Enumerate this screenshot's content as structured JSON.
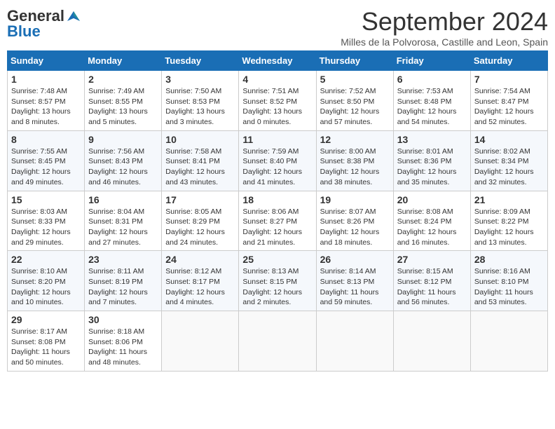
{
  "header": {
    "logo_general": "General",
    "logo_blue": "Blue",
    "month_title": "September 2024",
    "location": "Milles de la Polvorosa, Castille and Leon, Spain"
  },
  "weekdays": [
    "Sunday",
    "Monday",
    "Tuesday",
    "Wednesday",
    "Thursday",
    "Friday",
    "Saturday"
  ],
  "weeks": [
    [
      {
        "day": "1",
        "sunrise": "7:48 AM",
        "sunset": "8:57 PM",
        "daylight": "13 hours and 8 minutes."
      },
      {
        "day": "2",
        "sunrise": "7:49 AM",
        "sunset": "8:55 PM",
        "daylight": "13 hours and 5 minutes."
      },
      {
        "day": "3",
        "sunrise": "7:50 AM",
        "sunset": "8:53 PM",
        "daylight": "13 hours and 3 minutes."
      },
      {
        "day": "4",
        "sunrise": "7:51 AM",
        "sunset": "8:52 PM",
        "daylight": "13 hours and 0 minutes."
      },
      {
        "day": "5",
        "sunrise": "7:52 AM",
        "sunset": "8:50 PM",
        "daylight": "12 hours and 57 minutes."
      },
      {
        "day": "6",
        "sunrise": "7:53 AM",
        "sunset": "8:48 PM",
        "daylight": "12 hours and 54 minutes."
      },
      {
        "day": "7",
        "sunrise": "7:54 AM",
        "sunset": "8:47 PM",
        "daylight": "12 hours and 52 minutes."
      }
    ],
    [
      {
        "day": "8",
        "sunrise": "7:55 AM",
        "sunset": "8:45 PM",
        "daylight": "12 hours and 49 minutes."
      },
      {
        "day": "9",
        "sunrise": "7:56 AM",
        "sunset": "8:43 PM",
        "daylight": "12 hours and 46 minutes."
      },
      {
        "day": "10",
        "sunrise": "7:58 AM",
        "sunset": "8:41 PM",
        "daylight": "12 hours and 43 minutes."
      },
      {
        "day": "11",
        "sunrise": "7:59 AM",
        "sunset": "8:40 PM",
        "daylight": "12 hours and 41 minutes."
      },
      {
        "day": "12",
        "sunrise": "8:00 AM",
        "sunset": "8:38 PM",
        "daylight": "12 hours and 38 minutes."
      },
      {
        "day": "13",
        "sunrise": "8:01 AM",
        "sunset": "8:36 PM",
        "daylight": "12 hours and 35 minutes."
      },
      {
        "day": "14",
        "sunrise": "8:02 AM",
        "sunset": "8:34 PM",
        "daylight": "12 hours and 32 minutes."
      }
    ],
    [
      {
        "day": "15",
        "sunrise": "8:03 AM",
        "sunset": "8:33 PM",
        "daylight": "12 hours and 29 minutes."
      },
      {
        "day": "16",
        "sunrise": "8:04 AM",
        "sunset": "8:31 PM",
        "daylight": "12 hours and 27 minutes."
      },
      {
        "day": "17",
        "sunrise": "8:05 AM",
        "sunset": "8:29 PM",
        "daylight": "12 hours and 24 minutes."
      },
      {
        "day": "18",
        "sunrise": "8:06 AM",
        "sunset": "8:27 PM",
        "daylight": "12 hours and 21 minutes."
      },
      {
        "day": "19",
        "sunrise": "8:07 AM",
        "sunset": "8:26 PM",
        "daylight": "12 hours and 18 minutes."
      },
      {
        "day": "20",
        "sunrise": "8:08 AM",
        "sunset": "8:24 PM",
        "daylight": "12 hours and 16 minutes."
      },
      {
        "day": "21",
        "sunrise": "8:09 AM",
        "sunset": "8:22 PM",
        "daylight": "12 hours and 13 minutes."
      }
    ],
    [
      {
        "day": "22",
        "sunrise": "8:10 AM",
        "sunset": "8:20 PM",
        "daylight": "12 hours and 10 minutes."
      },
      {
        "day": "23",
        "sunrise": "8:11 AM",
        "sunset": "8:19 PM",
        "daylight": "12 hours and 7 minutes."
      },
      {
        "day": "24",
        "sunrise": "8:12 AM",
        "sunset": "8:17 PM",
        "daylight": "12 hours and 4 minutes."
      },
      {
        "day": "25",
        "sunrise": "8:13 AM",
        "sunset": "8:15 PM",
        "daylight": "12 hours and 2 minutes."
      },
      {
        "day": "26",
        "sunrise": "8:14 AM",
        "sunset": "8:13 PM",
        "daylight": "11 hours and 59 minutes."
      },
      {
        "day": "27",
        "sunrise": "8:15 AM",
        "sunset": "8:12 PM",
        "daylight": "11 hours and 56 minutes."
      },
      {
        "day": "28",
        "sunrise": "8:16 AM",
        "sunset": "8:10 PM",
        "daylight": "11 hours and 53 minutes."
      }
    ],
    [
      {
        "day": "29",
        "sunrise": "8:17 AM",
        "sunset": "8:08 PM",
        "daylight": "11 hours and 50 minutes."
      },
      {
        "day": "30",
        "sunrise": "8:18 AM",
        "sunset": "8:06 PM",
        "daylight": "11 hours and 48 minutes."
      },
      null,
      null,
      null,
      null,
      null
    ]
  ]
}
